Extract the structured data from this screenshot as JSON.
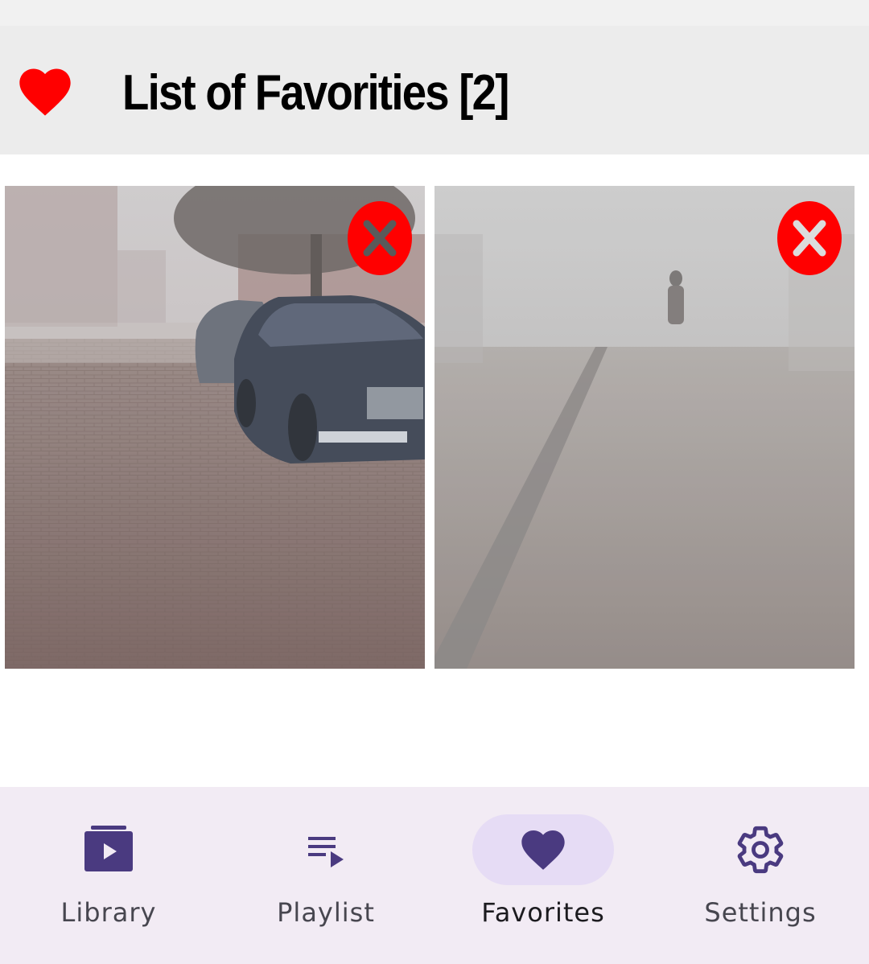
{
  "header": {
    "title": "List of Favorities [2]",
    "icon": "heart-icon",
    "icon_color": "#ff0000"
  },
  "favorites": {
    "items": [
      {
        "description": "foggy street with parked cars",
        "remove_icon": "close-icon"
      },
      {
        "description": "foggy road with pedestrian",
        "remove_icon": "close-icon"
      }
    ],
    "remove_color": "#ff0000"
  },
  "nav": {
    "items": [
      {
        "label": "Library",
        "icon": "video-library-icon",
        "active": false
      },
      {
        "label": "Playlist",
        "icon": "playlist-play-icon",
        "active": false
      },
      {
        "label": "Favorites",
        "icon": "heart-icon",
        "active": true
      },
      {
        "label": "Settings",
        "icon": "gear-icon",
        "active": false
      }
    ],
    "icon_color": "#4a3a80",
    "active_pill_color": "#e6dcf5"
  }
}
